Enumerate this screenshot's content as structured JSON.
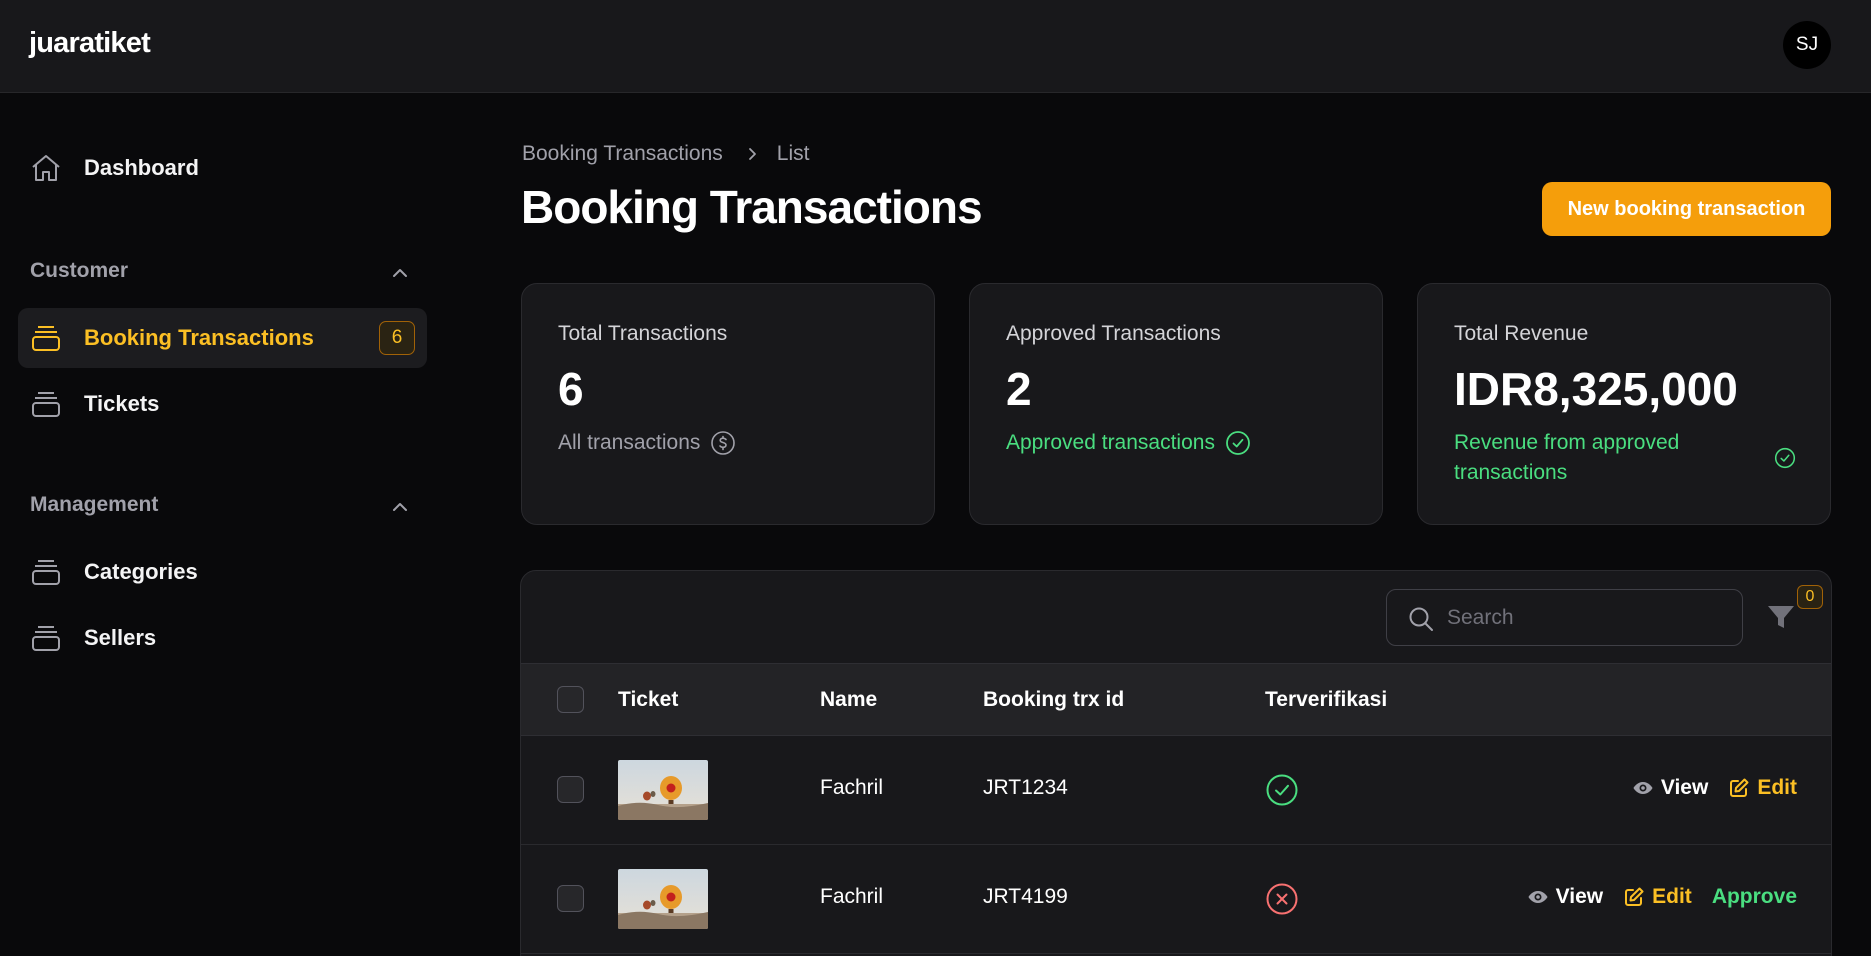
{
  "app": {
    "brand": "juaratiket",
    "user_initials": "SJ"
  },
  "sidebar": {
    "dashboard": {
      "label": "Dashboard",
      "icon": "home-icon"
    },
    "groups": [
      {
        "label": "Customer",
        "items": [
          {
            "label": "Booking Transactions",
            "badge": "6",
            "active": true,
            "icon": "stack-icon"
          },
          {
            "label": "Tickets",
            "icon": "stack-icon"
          }
        ]
      },
      {
        "label": "Management",
        "items": [
          {
            "label": "Categories",
            "icon": "stack-icon"
          },
          {
            "label": "Sellers",
            "icon": "stack-icon"
          }
        ]
      }
    ]
  },
  "header": {
    "breadcrumb": [
      "Booking Transactions",
      "List"
    ],
    "title": "Booking Transactions",
    "new_button": "New booking transaction"
  },
  "stats": [
    {
      "label": "Total Transactions",
      "value": "6",
      "description": "All transactions",
      "icon": "dollar-circle-icon",
      "tone": "muted"
    },
    {
      "label": "Approved Transactions",
      "value": "2",
      "description": "Approved transactions",
      "icon": "check-circle-icon",
      "tone": "green"
    },
    {
      "label": "Total Revenue",
      "value": "IDR8,325,000",
      "description": "Revenue from approved transactions",
      "icon": "check-circle-icon",
      "tone": "green"
    }
  ],
  "table": {
    "search_placeholder": "Search",
    "filter_count": "0",
    "columns": [
      "Ticket",
      "Name",
      "Booking trx id",
      "Terverifikasi"
    ],
    "rows": [
      {
        "name": "Fachril",
        "trx_id": "JRT1234",
        "verified": true,
        "actions": [
          "View",
          "Edit"
        ]
      },
      {
        "name": "Fachril",
        "trx_id": "JRT4199",
        "verified": false,
        "actions": [
          "View",
          "Edit",
          "Approve"
        ]
      }
    ]
  },
  "colors": {
    "accent": "#f59e0b",
    "accent_text": "#fbbf24",
    "success": "#4ade80",
    "danger": "#f87171",
    "background": "#09090b",
    "surface": "#18181b"
  }
}
